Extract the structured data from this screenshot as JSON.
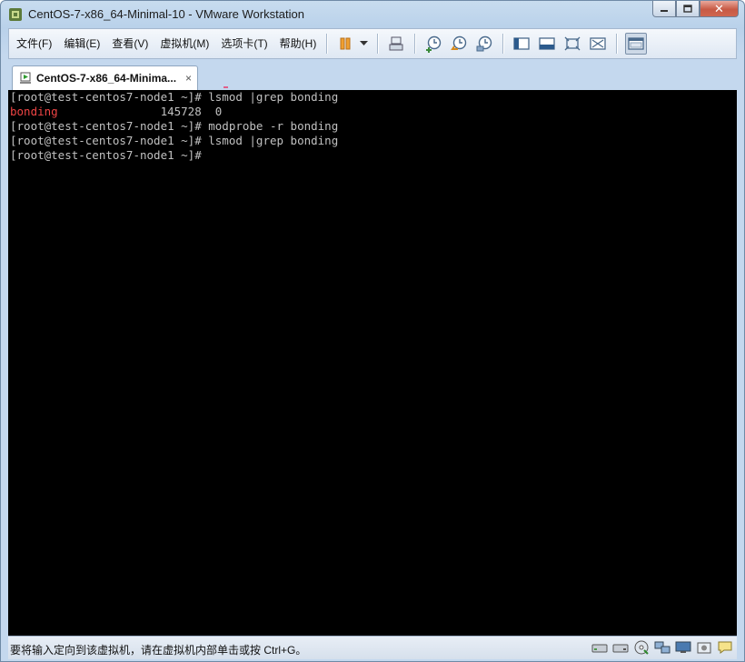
{
  "window": {
    "title": "CentOS-7-x86_64-Minimal-10 - VMware Workstation",
    "close_glyph": "✕",
    "minimize_glyph": "‒",
    "maximize_glyph": "□"
  },
  "menu": [
    {
      "label": "文件(F)"
    },
    {
      "label": "编辑(E)"
    },
    {
      "label": "查看(V)"
    },
    {
      "label": "虚拟机(M)"
    },
    {
      "label": "选项卡(T)"
    },
    {
      "label": "帮助(H)"
    }
  ],
  "toolbar": {
    "icons": [
      "pause-icon",
      "dropdown-arrow-icon",
      "send-ctrl-alt-del-icon",
      "snapshot-take-icon",
      "snapshot-revert-icon",
      "snapshot-manager-icon",
      "console-view-icon",
      "quick-switch-icon",
      "fullscreen-icon",
      "unity-icon",
      "thumbnail-bar-icon"
    ]
  },
  "tab": {
    "label": "CentOS-7-x86_64-Minima...",
    "close_glyph": "×"
  },
  "console": {
    "lines": [
      {
        "text": "[root@test-centos7-node1 ~]# lsmod |grep bonding"
      },
      {
        "prefix": "bonding",
        "rest": "               145728  0"
      },
      {
        "text": "[root@test-centos7-node1 ~]# modprobe -r bonding"
      },
      {
        "text": "[root@test-centos7-node1 ~]# lsmod |grep bonding"
      },
      {
        "text": "[root@test-centos7-node1 ~]# "
      }
    ],
    "prompt_color": "#c0c0c0",
    "highlight_color": "#ee4444"
  },
  "statusbar": {
    "message": "要将输入定向到该虚拟机，请在虚拟机内部单击或按 Ctrl+G。",
    "icons": [
      "hard-disk-icon",
      "network-adapter-icon",
      "cd-drive-icon",
      "usb-network-icon",
      "display-icon",
      "sound-icon",
      "message-icon"
    ]
  },
  "colors": {
    "title_bar": "#b9d1ea",
    "console_bg": "#000000"
  }
}
